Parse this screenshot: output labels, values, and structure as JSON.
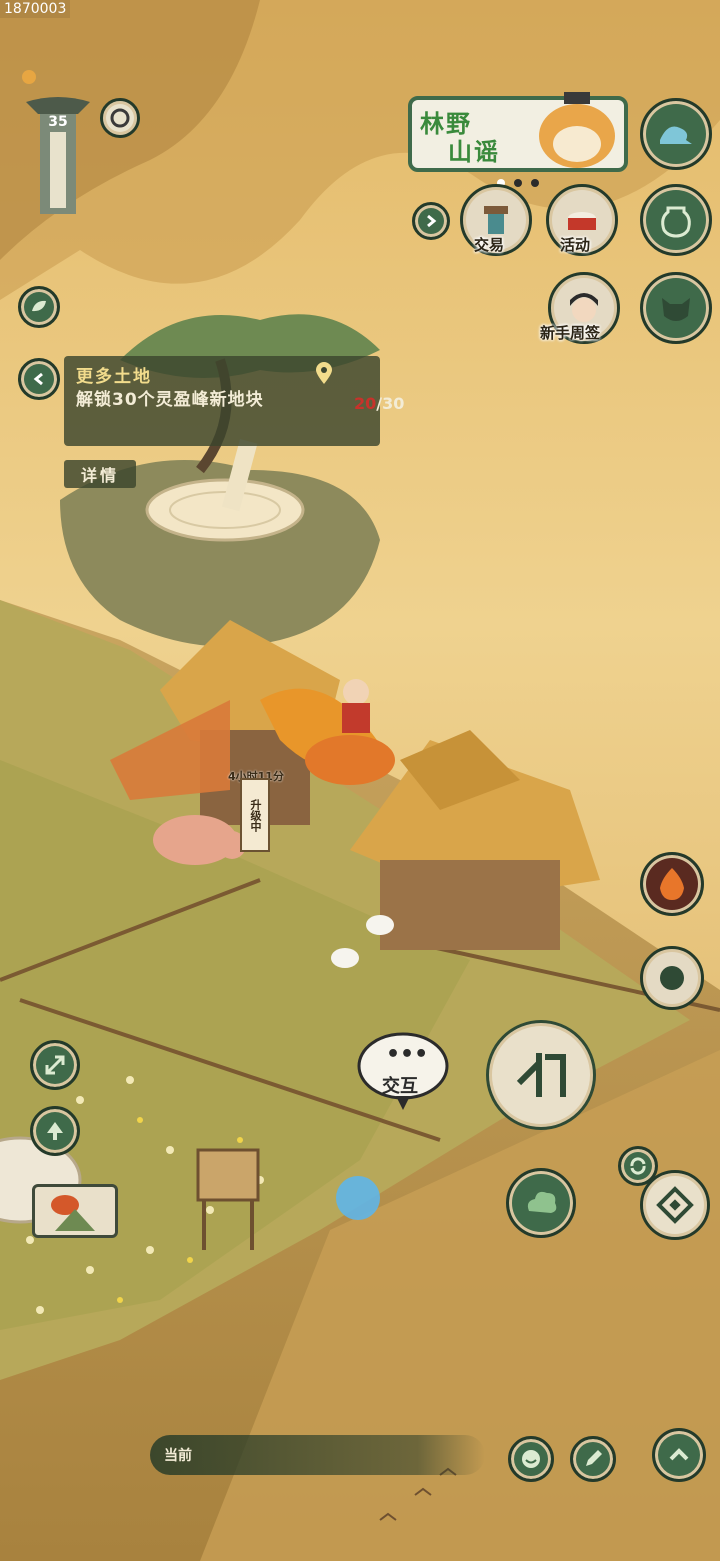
{
  "watermark": "1870003",
  "player": {
    "level": "35"
  },
  "banner": {
    "line1": "林野",
    "line2": "山谣"
  },
  "shortcuts": [
    {
      "label": "交易",
      "icon": "trade-icon"
    },
    {
      "label": "活动",
      "icon": "drum-icon"
    },
    {
      "label": "新手周签",
      "icon": "character-avatar-icon"
    }
  ],
  "quest": {
    "title": "更多土地",
    "description": "解锁30个灵盈峰新地块",
    "progress_current": "20",
    "progress_total": "/30",
    "detail_label": "详情"
  },
  "building": {
    "timer": "4小时11分",
    "status": "升级中"
  },
  "interact": {
    "label": "交互",
    "dots": "•••"
  },
  "chat": {
    "channel": "当前"
  },
  "colors": {
    "button_green": "#3f6a4a",
    "button_border": "#243a2a",
    "progress_red": "#c8322b",
    "quest_title": "#f2dc8c"
  }
}
